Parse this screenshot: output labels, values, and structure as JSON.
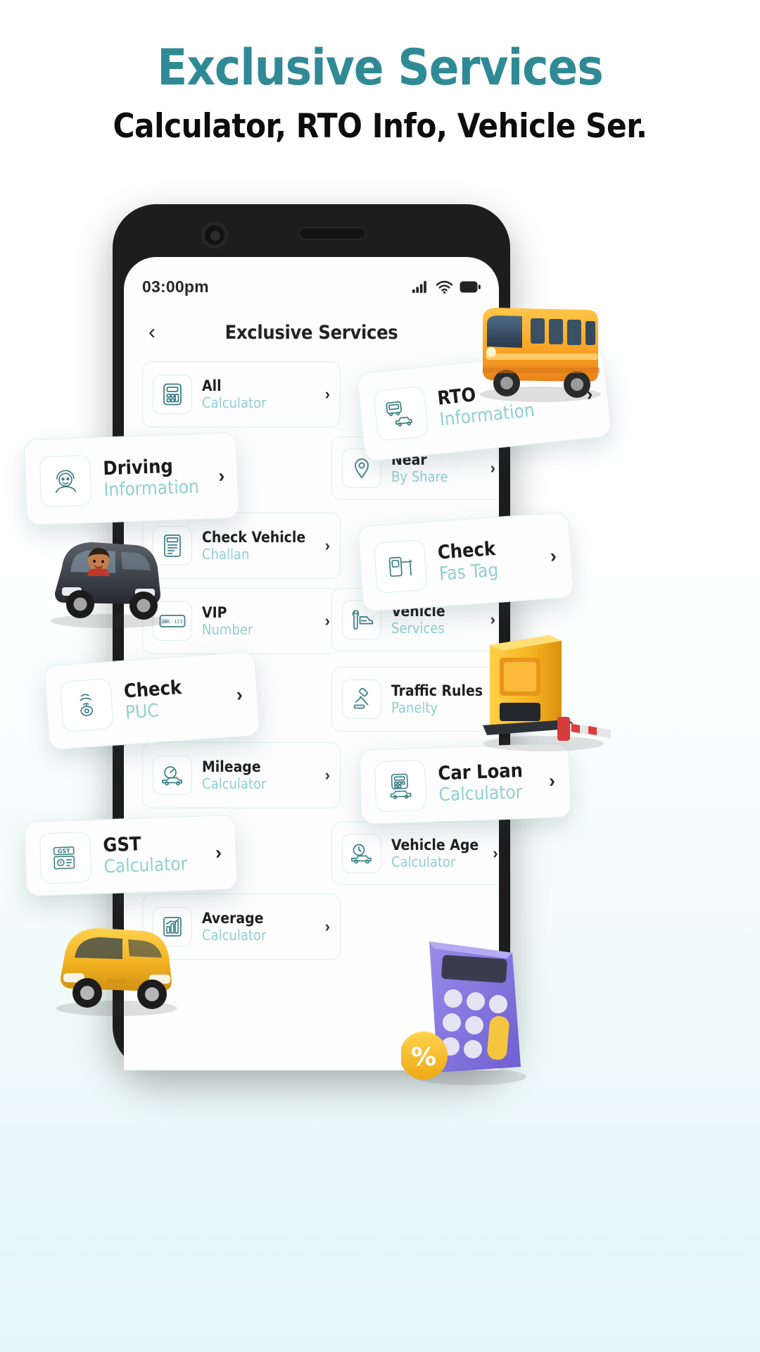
{
  "promo": {
    "title": "Exclusive Services",
    "subtitle": "Calculator, RTO Info, Vehicle Ser.",
    "title_color": "#2f8a96",
    "subtitle_color": "#0d0d0d"
  },
  "phone": {
    "statusbar": {
      "time": "03:00pm",
      "icons": [
        "signal-icon",
        "wifi-icon",
        "battery-icon"
      ]
    },
    "appbar": {
      "back_label": "‹",
      "title": "Exclusive Services"
    }
  },
  "theme": {
    "accent": "#8fd0cf",
    "border": "#dff0ee",
    "icon_stroke": "#3b7f86",
    "text": "#1f1f1f"
  },
  "services": [
    {
      "id": "all-calculator",
      "main": "All",
      "sub": "Calculator",
      "icon": "calculator-icon",
      "chevron": "›",
      "floating": false
    },
    {
      "id": "rto-information",
      "main": "RTO",
      "sub": "Information",
      "icon": "rto-vehicles-icon",
      "chevron": "›",
      "floating": true
    },
    {
      "id": "driving-information",
      "main": "Driving",
      "sub": "Information",
      "icon": "driver-face-icon",
      "chevron": "›",
      "floating": true
    },
    {
      "id": "near-by-share",
      "main": "Near",
      "sub": "By Share",
      "icon": "location-pin-icon",
      "chevron": "›",
      "floating": false
    },
    {
      "id": "check-vehicle-challan",
      "main": "Check Vehicle",
      "sub": "Challan",
      "icon": "challan-doc-icon",
      "chevron": "›",
      "floating": false
    },
    {
      "id": "check-fas-tag",
      "main": "Check",
      "sub": "Fas Tag",
      "icon": "toll-booth-icon",
      "chevron": "›",
      "floating": true
    },
    {
      "id": "vip-number",
      "main": "VIP",
      "sub": "Number",
      "icon": "number-plate-icon",
      "chevron": "›",
      "floating": false
    },
    {
      "id": "vehicle-services",
      "main": "Vehicle",
      "sub": "Services",
      "icon": "wrench-car-icon",
      "chevron": "›",
      "floating": false
    },
    {
      "id": "check-puc",
      "main": "Check",
      "sub": "PUC",
      "icon": "puc-smoke-icon",
      "chevron": "›",
      "floating": true
    },
    {
      "id": "traffic-rules-panelty",
      "main": "Traffic Rules",
      "sub": "Panelty",
      "icon": "gavel-icon",
      "chevron": "›",
      "floating": false
    },
    {
      "id": "mileage-calculator",
      "main": "Mileage",
      "sub": "Calculator",
      "icon": "speedometer-car-icon",
      "chevron": "›",
      "floating": false
    },
    {
      "id": "car-loan-calculator",
      "main": "Car Loan",
      "sub": "Calculator",
      "icon": "loan-car-icon",
      "chevron": "›",
      "floating": true
    },
    {
      "id": "gst-calculator",
      "main": "GST",
      "sub": "Calculator",
      "icon": "gst-doc-icon",
      "chevron": "›",
      "floating": true
    },
    {
      "id": "vehicle-age-calculator",
      "main": "Vehicle Age",
      "sub": "Calculator",
      "icon": "clock-car-icon",
      "chevron": "›",
      "floating": false
    },
    {
      "id": "average-calculator",
      "main": "Average",
      "sub": "Calculator",
      "icon": "chart-calc-icon",
      "chevron": "›",
      "floating": false
    }
  ],
  "decorations": [
    {
      "id": "school-bus",
      "name": "school-bus-3d"
    },
    {
      "id": "black-car",
      "name": "black-car-driver-3d"
    },
    {
      "id": "toll-booth",
      "name": "toll-booth-3d"
    },
    {
      "id": "yellow-car",
      "name": "yellow-car-3d"
    },
    {
      "id": "calculator",
      "name": "calculator-3d"
    }
  ]
}
